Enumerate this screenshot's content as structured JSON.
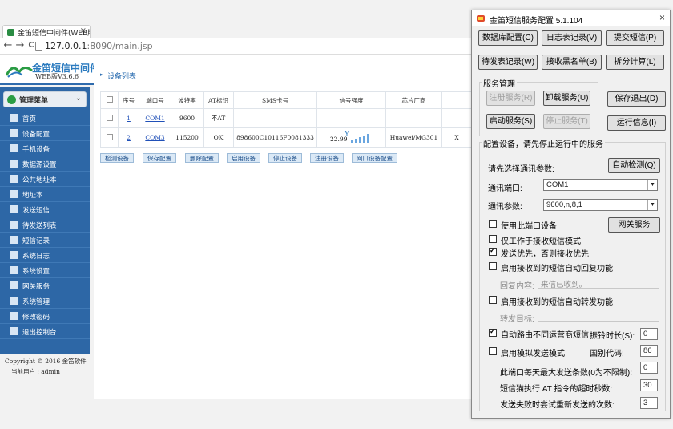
{
  "browser": {
    "tab_title": "金笛短信中间件(WEB版)",
    "tab_close": "×",
    "url_host": "127.0.0.1",
    "url_rest": ":8090/main.jsp",
    "back": "←",
    "forward": "→",
    "reload": "C"
  },
  "app": {
    "title": "金笛短信中间件",
    "version": "WEB版V3.6.6"
  },
  "sidebar": {
    "header": "管理菜单",
    "items": [
      {
        "label": "首页",
        "icon": "home-icon"
      },
      {
        "label": "设备配置",
        "icon": "config-icon"
      },
      {
        "label": "手机设备",
        "icon": "phone-icon"
      },
      {
        "label": "数据源设置",
        "icon": "database-icon"
      },
      {
        "label": "公共地址本",
        "icon": "addressbook-icon"
      },
      {
        "label": "地址本",
        "icon": "contacts-icon"
      },
      {
        "label": "发送短信",
        "icon": "mail-icon"
      },
      {
        "label": "待发送列表",
        "icon": "queue-icon"
      },
      {
        "label": "短信记录",
        "icon": "records-icon"
      },
      {
        "label": "系统日志",
        "icon": "log-icon"
      },
      {
        "label": "系统设置",
        "icon": "settings-icon"
      },
      {
        "label": "网关服务",
        "icon": "gateway-icon"
      },
      {
        "label": "系统管理",
        "icon": "users-icon"
      },
      {
        "label": "修改密码",
        "icon": "key-icon"
      },
      {
        "label": "退出控制台",
        "icon": "logout-icon"
      }
    ],
    "copyright": "Copyright © 2016  金笛软件",
    "current_user": "当前用户 : admin"
  },
  "main": {
    "heading": "设备列表",
    "columns": [
      "序号",
      "端口号",
      "波特率",
      "AT标识",
      "SMS卡号",
      "信号强度",
      "芯片厂商"
    ],
    "rows": [
      {
        "idx": "1",
        "port": "COM1",
        "baud": "9600",
        "at": "不AT",
        "sms": "——",
        "signal": "——",
        "vendor": "——"
      },
      {
        "idx": "2",
        "port": "COM3",
        "baud": "115200",
        "at": "OK",
        "sms": "898600C10116F0081333",
        "signal": "22.99",
        "vendor": "Huawei/MG301"
      }
    ],
    "buttons": [
      "检测设备",
      "保存配置",
      "删除配置",
      "启用设备",
      "停止设备",
      "注册设备",
      "网口设备配置"
    ]
  },
  "dialog": {
    "title": "金笛短信服务配置 5.1.104",
    "close": "×",
    "top_buttons": [
      "数据库配置(C)",
      "日志表记录(V)",
      "提交短信(P)",
      "待发表记录(W)",
      "接收黑名单(B)",
      "拆分计算(L)"
    ],
    "service_group": "服务管理",
    "register_service": "注册服务(R)",
    "uninstall_service": "卸载服务(U)",
    "start_service": "启动服务(S)",
    "stop_service": "停止服务(T)",
    "save_exit": "保存退出(D)",
    "run_info": "运行信息(I)",
    "device_group": "配置设备，请先停止运行中的服务",
    "choose_params": "请先选择通讯参数:",
    "auto_detect": "自动检测(Q)",
    "port_label": "通讯端口:",
    "port_value": "COM1",
    "param_label": "通讯参数:",
    "param_value": "9600,n,8,1",
    "use_port": "使用此端口设备",
    "recv_only": "仅工作于接收短信模式",
    "send_first": "发送优先，否则接收优先",
    "auto_reply": "启用接收到的短信自动回复功能",
    "reply_label": "回复内容:",
    "reply_value": "来信已收到。",
    "auto_forward": "启用接收到的短信自动转发功能",
    "forward_label": "转发目标:",
    "forward_value": "",
    "gateway_service": "网关服务",
    "auto_route": "自动路由不同运营商短信",
    "ring_label": "振铃时长(S):",
    "ring_value": "0",
    "sim_mode": "启用模拟发送模式",
    "country_label": "国别代码:",
    "country_value": "86",
    "max_send_label": "此端口每天最大发送条数(0为不限制):",
    "max_send_value": "0",
    "timeout_label": "短信猫执行 AT 指令的超时秒数:",
    "timeout_value": "30",
    "retry_label": "发送失败时尝试重新发送的次数:",
    "retry_value": "3",
    "use_port_checked": false,
    "recv_only_checked": false,
    "send_first_checked": true,
    "auto_reply_checked": false,
    "auto_forward_checked": false,
    "auto_route_checked": true,
    "sim_mode_checked": false
  }
}
